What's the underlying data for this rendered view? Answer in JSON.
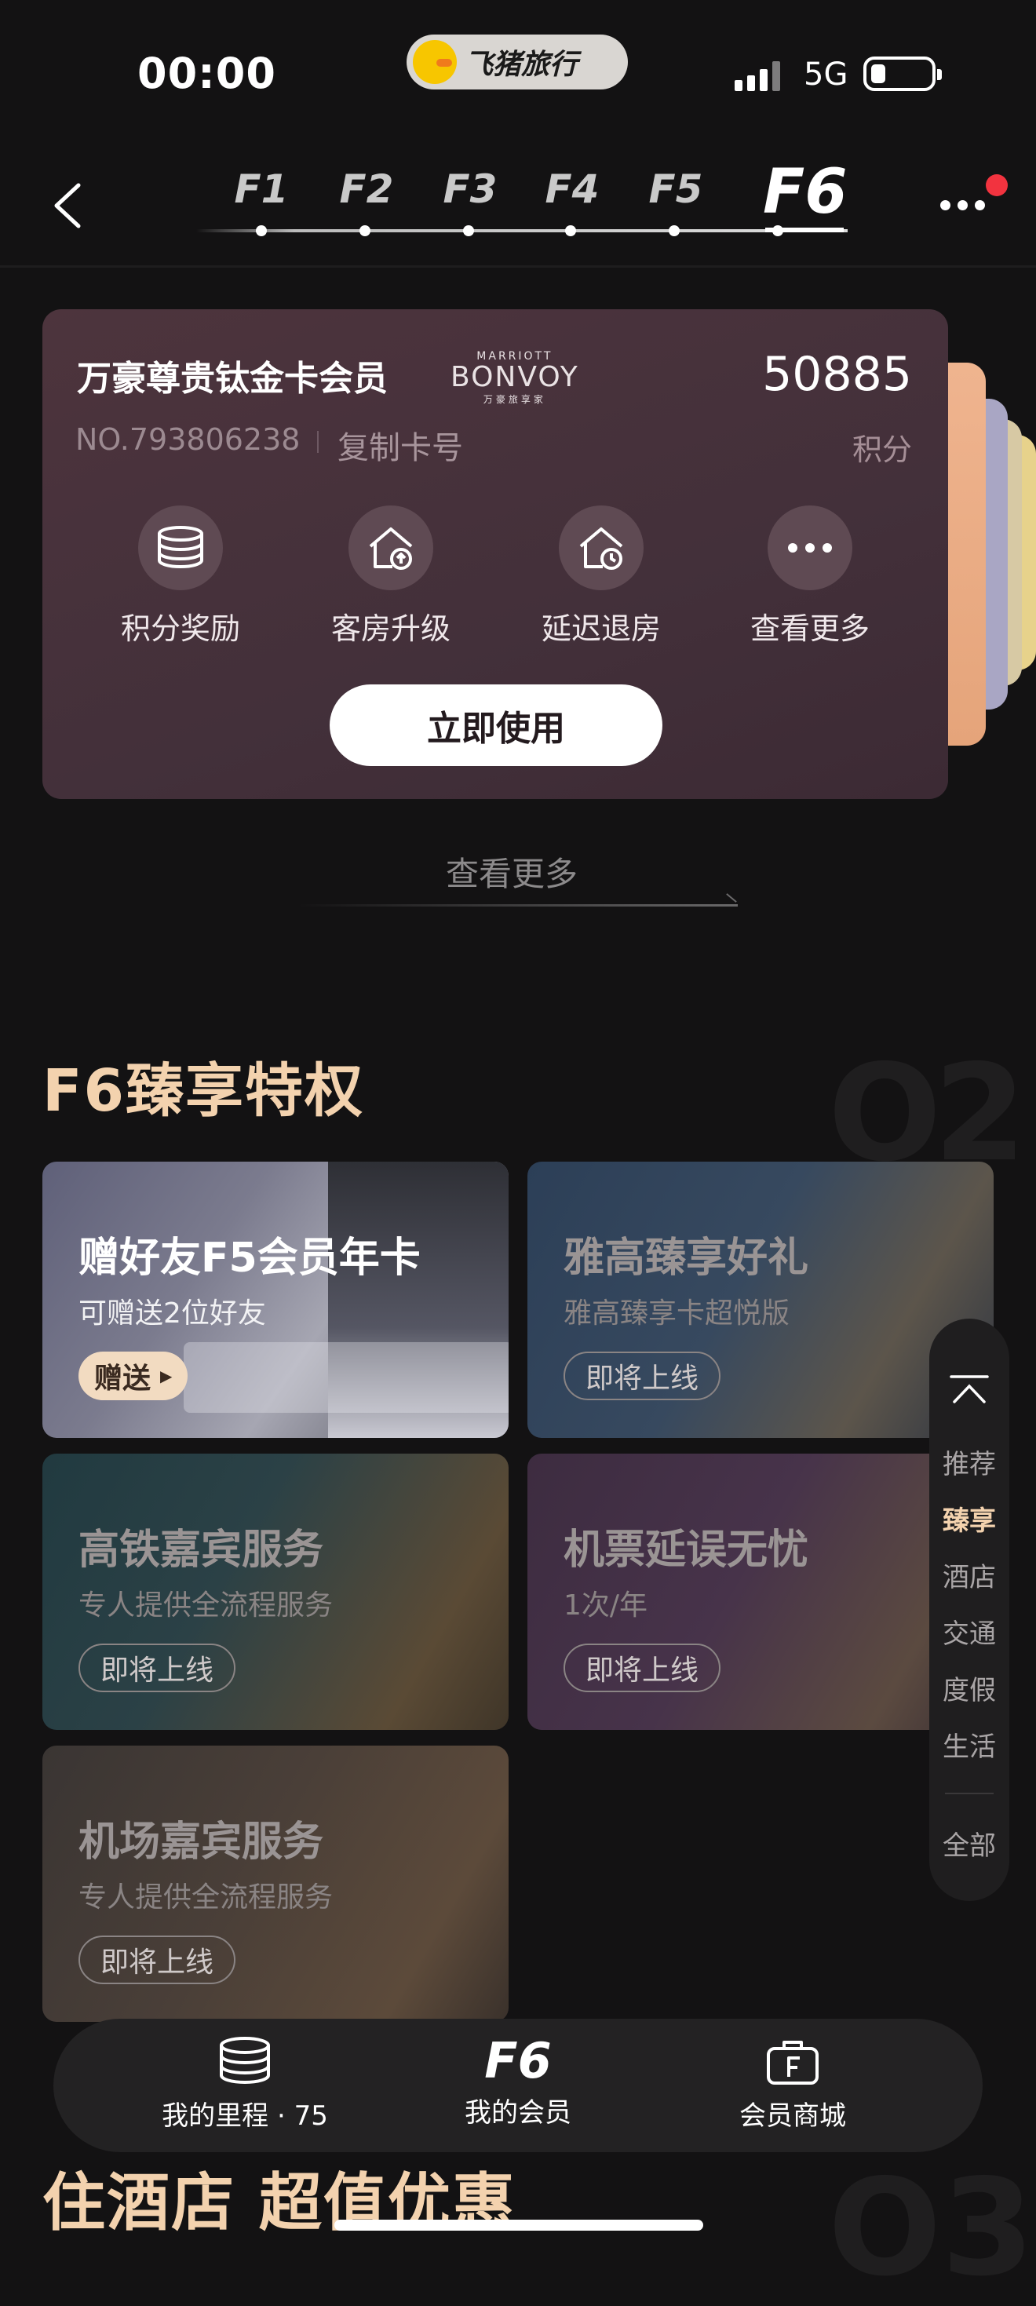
{
  "status_bar": {
    "time": "00:00",
    "app_pill": "飞猪旅行",
    "network": "5G",
    "icons": [
      "signal-icon",
      "battery-icon",
      "fliggy-duck-icon"
    ]
  },
  "level_nav": {
    "levels": [
      "F1",
      "F2",
      "F3",
      "F4",
      "F5",
      "F6"
    ],
    "active": "F6"
  },
  "member_card": {
    "title": "万豪尊贵钛金卡会员",
    "brand_small": "MARRIOTT",
    "brand": "BONVOY",
    "brand_tag": "万豪旅享家",
    "card_no": "NO.793806238",
    "copy_label": "复制卡号",
    "points": "50885",
    "points_label": "积分",
    "benefits": [
      {
        "label": "积分奖励",
        "icon": "coins-icon"
      },
      {
        "label": "客房升级",
        "icon": "house-upgrade-icon"
      },
      {
        "label": "延迟退房",
        "icon": "house-clock-icon"
      },
      {
        "label": "查看更多",
        "icon": "more-dots-icon"
      }
    ],
    "use_button": "立即使用",
    "stack_colors": [
      "#e8a67c",
      "#a9a6c4",
      "#d7c9a4",
      "#e7d28b"
    ]
  },
  "view_more": "查看更多",
  "privilege_section": {
    "title": "F6臻享特权",
    "tiles": [
      {
        "title": "赠好友F5会员年卡",
        "subtitle": "可赠送2位好友",
        "button": "赠送"
      },
      {
        "title": "雅高臻享好礼",
        "subtitle": "雅高臻享卡超悦版",
        "button": "即将上线"
      },
      {
        "title": "高铁嘉宾服务",
        "subtitle": "专人提供全流程服务",
        "button": "即将上线"
      },
      {
        "title": "机票延误无忧",
        "subtitle": "1次/年",
        "button": "即将上线"
      },
      {
        "title": "机场嘉宾服务",
        "subtitle": "专人提供全流程服务",
        "button": "即将上线"
      }
    ]
  },
  "side_nav": {
    "items": [
      "推荐",
      "臻享",
      "酒店",
      "交通",
      "度假",
      "生活"
    ],
    "all": "全部",
    "active": "臻享"
  },
  "bottom_bar": {
    "items": [
      {
        "label": "我的里程 · 75",
        "icon": "coins-icon"
      },
      {
        "label": "我的会员",
        "icon": "f6-icon"
      },
      {
        "label": "会员商城",
        "icon": "shop-bag-icon"
      }
    ]
  },
  "hotel_section": {
    "title": "住酒店 超值优惠"
  },
  "colors": {
    "accent_gold": "#f3d2ae",
    "notification": "#f2333f",
    "card_bg": "#4d343d"
  }
}
